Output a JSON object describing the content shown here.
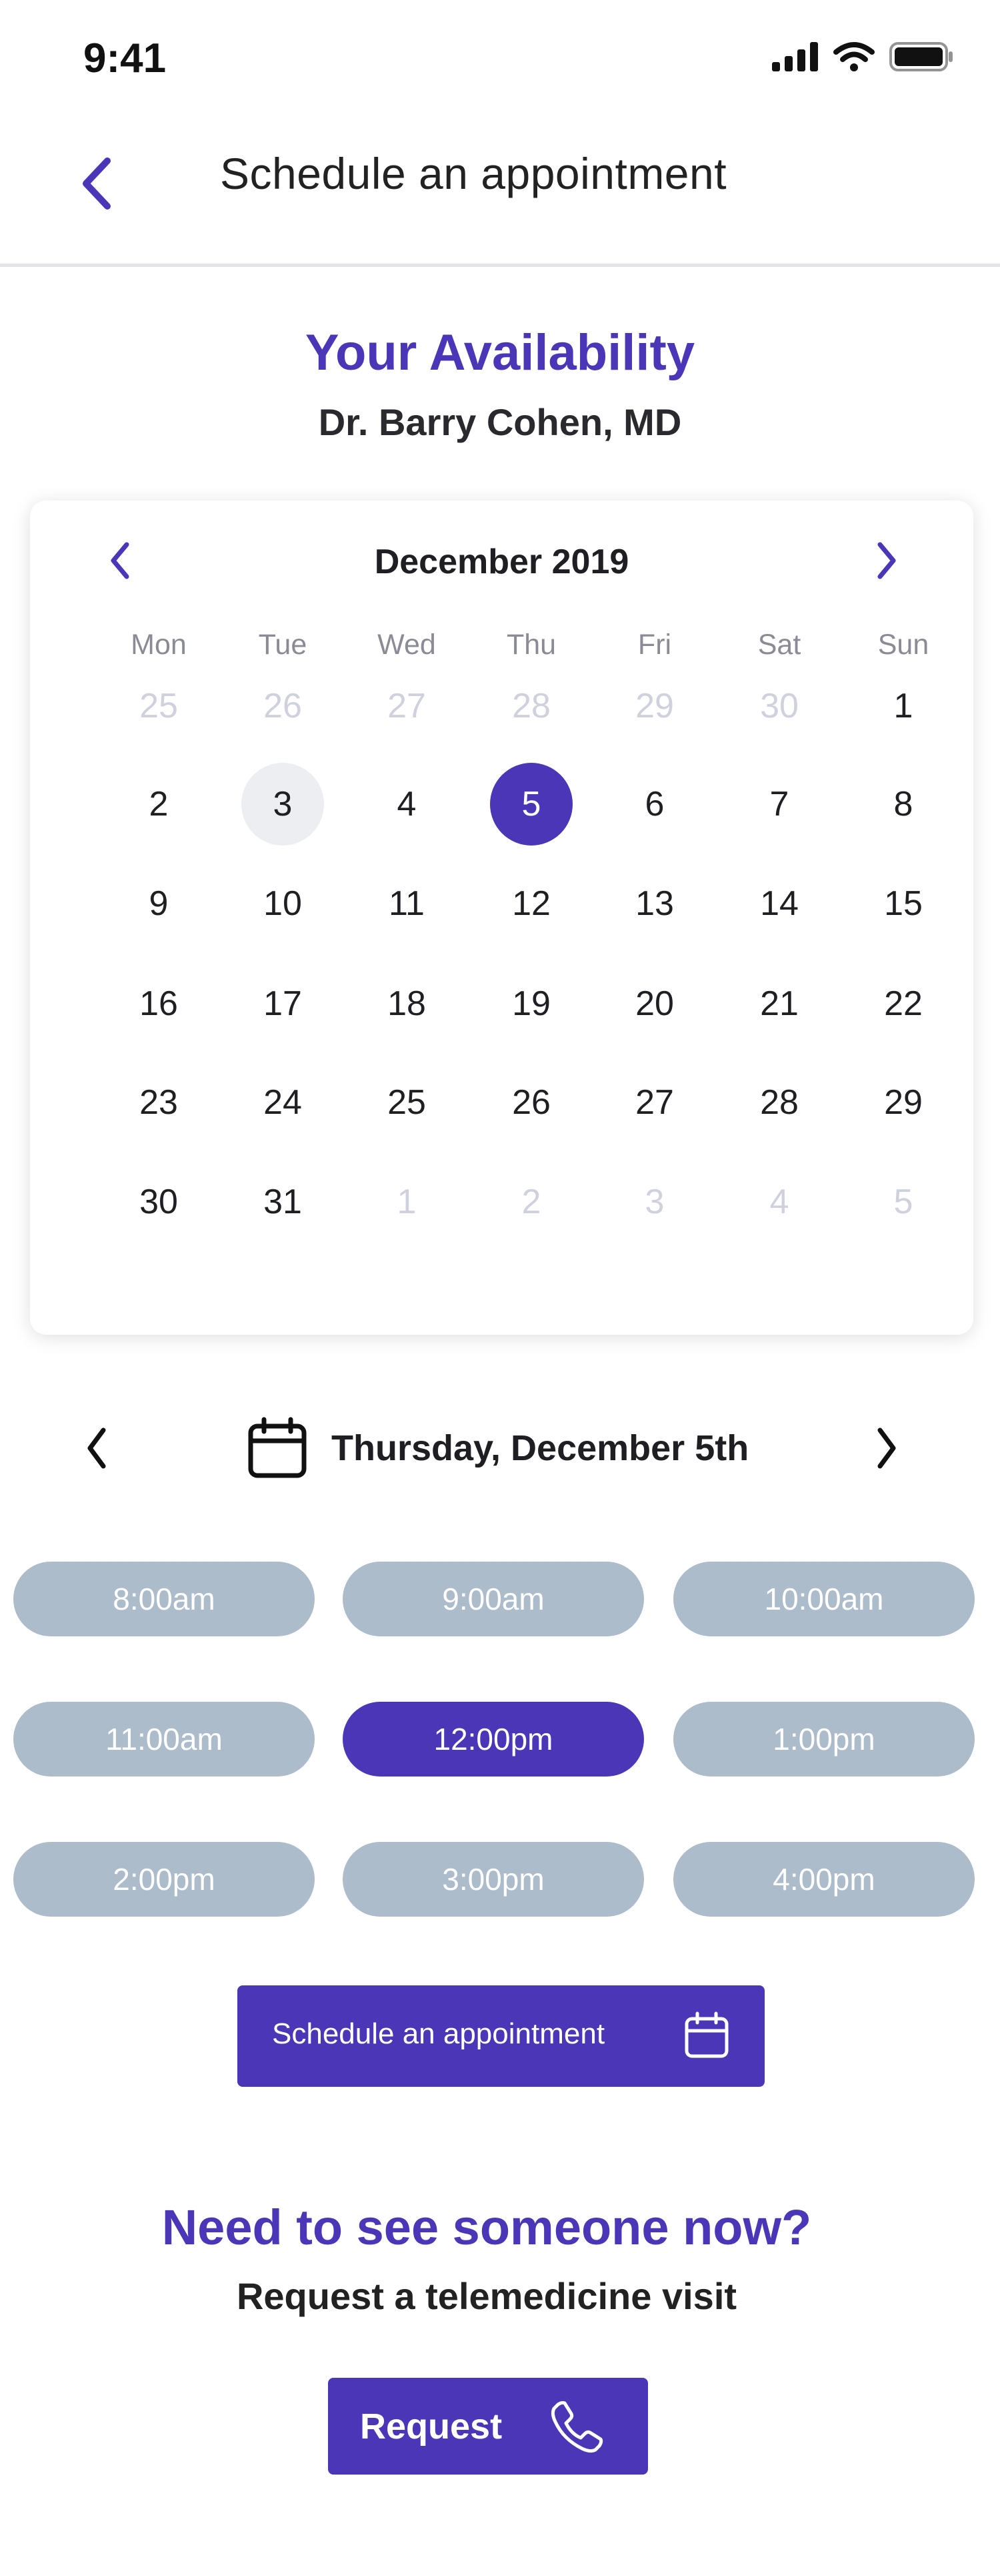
{
  "status_bar": {
    "time": "9:41"
  },
  "header": {
    "title": "Schedule an appointment",
    "back_icon": "chevron-left-icon"
  },
  "availability": {
    "title": "Your Availability",
    "doctor": "Dr. Barry Cohen, MD"
  },
  "calendar": {
    "month": "December 2019",
    "weekdays": [
      "Mon",
      "Tue",
      "Wed",
      "Thu",
      "Fri",
      "Sat",
      "Sun"
    ],
    "weeks": [
      [
        {
          "d": "25",
          "m": true
        },
        {
          "d": "26",
          "m": true
        },
        {
          "d": "27",
          "m": true
        },
        {
          "d": "28",
          "m": true
        },
        {
          "d": "29",
          "m": true
        },
        {
          "d": "30",
          "m": true
        },
        {
          "d": "1"
        }
      ],
      [
        {
          "d": "2"
        },
        {
          "d": "3",
          "today": true
        },
        {
          "d": "4"
        },
        {
          "d": "5",
          "selected": true
        },
        {
          "d": "6"
        },
        {
          "d": "7"
        },
        {
          "d": "8"
        }
      ],
      [
        {
          "d": "9"
        },
        {
          "d": "10"
        },
        {
          "d": "11"
        },
        {
          "d": "12"
        },
        {
          "d": "13"
        },
        {
          "d": "14"
        },
        {
          "d": "15"
        }
      ],
      [
        {
          "d": "16"
        },
        {
          "d": "17"
        },
        {
          "d": "18"
        },
        {
          "d": "19"
        },
        {
          "d": "20"
        },
        {
          "d": "21"
        },
        {
          "d": "22"
        }
      ],
      [
        {
          "d": "23"
        },
        {
          "d": "24"
        },
        {
          "d": "25"
        },
        {
          "d": "26"
        },
        {
          "d": "27"
        },
        {
          "d": "28"
        },
        {
          "d": "29"
        }
      ],
      [
        {
          "d": "30"
        },
        {
          "d": "31"
        },
        {
          "d": "1",
          "m": true
        },
        {
          "d": "2",
          "m": true
        },
        {
          "d": "3",
          "m": true
        },
        {
          "d": "4",
          "m": true
        },
        {
          "d": "5",
          "m": true
        }
      ]
    ]
  },
  "date_selector": {
    "label": "Thursday, December 5th"
  },
  "time_slots": [
    {
      "label": "8:00am"
    },
    {
      "label": "9:00am"
    },
    {
      "label": "10:00am"
    },
    {
      "label": "11:00am"
    },
    {
      "label": "12:00pm",
      "selected": true
    },
    {
      "label": "1:00pm"
    },
    {
      "label": "2:00pm"
    },
    {
      "label": "3:00pm"
    },
    {
      "label": "4:00pm"
    }
  ],
  "schedule_button": {
    "label": "Schedule an appointment"
  },
  "telemedicine": {
    "title": "Need to see someone now?",
    "subtitle": "Request a telemedicine visit",
    "button_label": "Request"
  },
  "colors": {
    "accent": "#4b36b8",
    "slot_inactive": "#acbccb",
    "muted_day": "#cfd1dd",
    "today_bg": "#eceef1"
  }
}
